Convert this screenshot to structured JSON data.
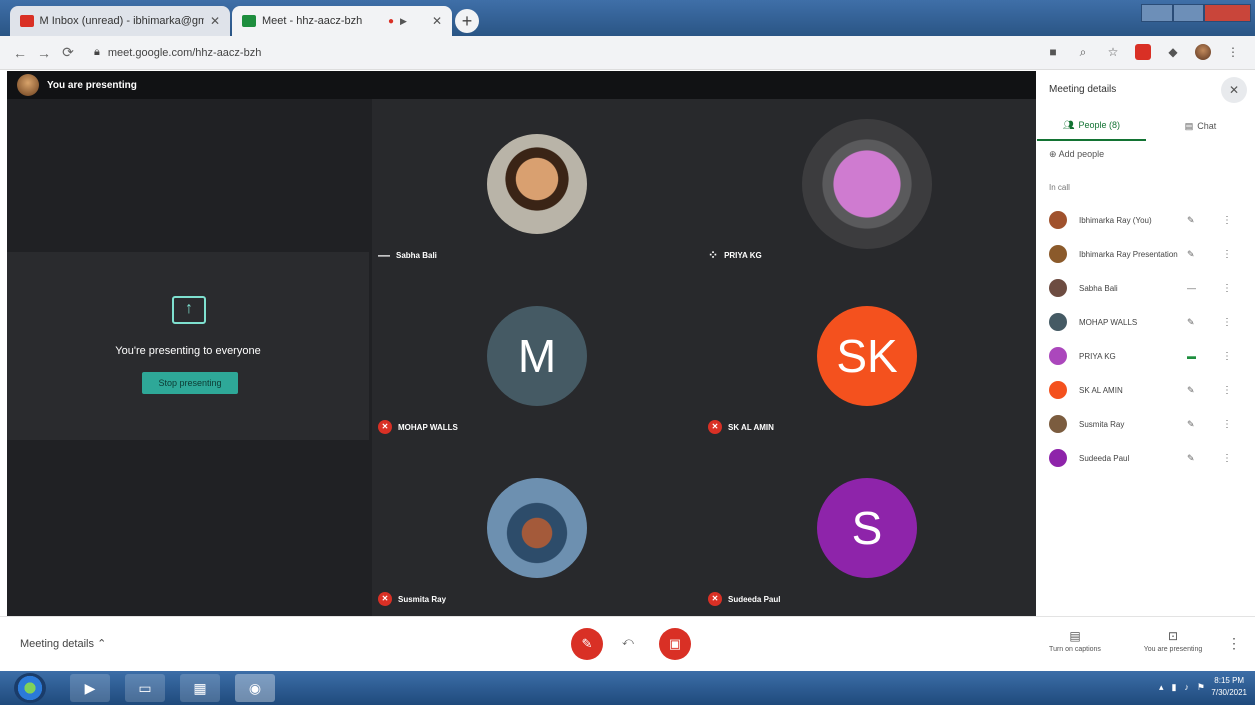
{
  "browser": {
    "tabs": [
      {
        "title": "M  Inbox (unread) - ibhimarka@gmail.com"
      },
      {
        "title": "Meet - hhz-aacz-bzh"
      }
    ],
    "url": "meet.google.com/hhz-aacz-bzh"
  },
  "meet": {
    "presenting_banner": "You are presenting",
    "present_message": "You're presenting to everyone",
    "stop_presenting_label": "Stop presenting",
    "tiles": [
      {
        "name": "Sabha Bali",
        "initials": "",
        "color": "",
        "muted": false
      },
      {
        "name": "PRIYA KG",
        "initials": "",
        "color": "",
        "muted": false
      },
      {
        "name": "MOHAP WALLS",
        "initials": "M",
        "color": "#455a64",
        "muted": true
      },
      {
        "name": "SK AL AMIN",
        "initials": "SK",
        "color": "#f4511e",
        "muted": true
      },
      {
        "name": "Susmita Ray",
        "initials": "",
        "color": "",
        "muted": true
      },
      {
        "name": "Sudeeda Paul",
        "initials": "S",
        "color": "#8e24aa",
        "muted": true
      }
    ]
  },
  "side_panel": {
    "title": "Meeting details",
    "tabs": [
      {
        "label": "People (8)",
        "icon": "people-icon"
      },
      {
        "label": "Chat",
        "icon": "chat-icon"
      }
    ],
    "add_people_label": "Add people",
    "section_label": "In call",
    "people": [
      {
        "name": "Ibhimarka Ray (You)",
        "color": "#a0522d",
        "mic": "muted"
      },
      {
        "name": "Ibhimarka Ray Presentation",
        "color": "#8b5a2b",
        "mic": "muted"
      },
      {
        "name": "Sabha Bali",
        "color": "#6d4c41",
        "mic": "speaking-idle"
      },
      {
        "name": "MOHAP WALLS",
        "color": "#455a64",
        "mic": "muted"
      },
      {
        "name": "PRIYA KG",
        "color": "#ab47bc",
        "mic": "speaking"
      },
      {
        "name": "SK AL AMIN",
        "color": "#f4511e",
        "mic": "muted"
      },
      {
        "name": "Susmita Ray",
        "color": "#7b5c3f",
        "mic": "muted"
      },
      {
        "name": "Sudeeda Paul",
        "color": "#8e24aa",
        "mic": "muted"
      }
    ]
  },
  "bottom_bar": {
    "meeting_details_label": "Meeting details",
    "captions_label": "Turn on captions",
    "present_label": "You are presenting"
  },
  "taskbar": {
    "time": "8:15 PM",
    "date": "7/30/2021"
  }
}
